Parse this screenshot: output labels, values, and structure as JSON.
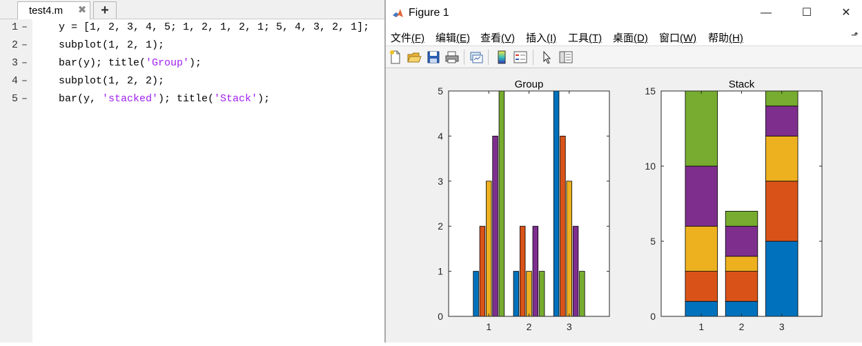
{
  "editor": {
    "tab_label": "test4.m",
    "tab_close": "✖",
    "add_tab": "+",
    "lines": [
      {
        "num": "1",
        "dash": "–",
        "code": [
          {
            "t": "y = [1, 2, 3, 4, 5; 1, 2, 1, 2, 1; 5, 4, 3, 2, 1];",
            "s": false
          }
        ]
      },
      {
        "num": "2",
        "dash": "–",
        "code": [
          {
            "t": "subplot(1, 2, 1);",
            "s": false
          }
        ]
      },
      {
        "num": "3",
        "dash": "–",
        "code": [
          {
            "t": "bar(y); title(",
            "s": false
          },
          {
            "t": "'Group'",
            "s": true
          },
          {
            "t": ");",
            "s": false
          }
        ]
      },
      {
        "num": "4",
        "dash": "–",
        "code": [
          {
            "t": "subplot(1, 2, 2);",
            "s": false
          }
        ]
      },
      {
        "num": "5",
        "dash": "–",
        "code": [
          {
            "t": "bar(y, ",
            "s": false
          },
          {
            "t": "'stacked'",
            "s": true
          },
          {
            "t": "); title(",
            "s": false
          },
          {
            "t": "'Stack'",
            "s": true
          },
          {
            "t": ");",
            "s": false
          }
        ]
      }
    ]
  },
  "figure": {
    "title": "Figure 1",
    "window_buttons": {
      "minimize": "—",
      "maximize": "☐",
      "close": "✕"
    },
    "menu": [
      {
        "label": "文件",
        "key": "(F)"
      },
      {
        "label": "编辑",
        "key": "(E)"
      },
      {
        "label": "查看",
        "key": "(V)"
      },
      {
        "label": "插入",
        "key": "(I)"
      },
      {
        "label": "工具",
        "key": "(T)"
      },
      {
        "label": "桌面",
        "key": "(D)"
      },
      {
        "label": "窗口",
        "key": "(W)"
      },
      {
        "label": "帮助",
        "key": "(H)"
      }
    ],
    "menu_overflow": "⬏",
    "toolbar_icons": [
      "new-figure-icon",
      "open-file-icon",
      "save-icon",
      "print-icon",
      "link-plot-icon",
      "colorbar-icon",
      "legend-icon",
      "edit-plot-arrow-icon",
      "property-inspector-icon"
    ]
  },
  "colors": [
    "#0072bd",
    "#d95319",
    "#edb120",
    "#7e2f8e",
    "#77ac30"
  ],
  "chart_data": [
    {
      "type": "bar",
      "mode": "grouped",
      "title": "Group",
      "categories": [
        "1",
        "2",
        "3"
      ],
      "series": [
        {
          "values": [
            1,
            1,
            5
          ]
        },
        {
          "values": [
            2,
            2,
            4
          ]
        },
        {
          "values": [
            3,
            1,
            3
          ]
        },
        {
          "values": [
            4,
            2,
            2
          ]
        },
        {
          "values": [
            5,
            1,
            1
          ]
        }
      ],
      "ylim": [
        0,
        5
      ],
      "yticks": [
        "0",
        "1",
        "2",
        "3",
        "4",
        "5"
      ],
      "grid": false
    },
    {
      "type": "bar",
      "mode": "stacked",
      "title": "Stack",
      "categories": [
        "1",
        "2",
        "3"
      ],
      "series": [
        {
          "values": [
            1,
            1,
            5
          ]
        },
        {
          "values": [
            2,
            2,
            4
          ]
        },
        {
          "values": [
            3,
            1,
            3
          ]
        },
        {
          "values": [
            4,
            2,
            2
          ]
        },
        {
          "values": [
            5,
            1,
            1
          ]
        }
      ],
      "ylim": [
        0,
        15
      ],
      "yticks": [
        "0",
        "5",
        "10",
        "15"
      ],
      "grid": false
    }
  ]
}
